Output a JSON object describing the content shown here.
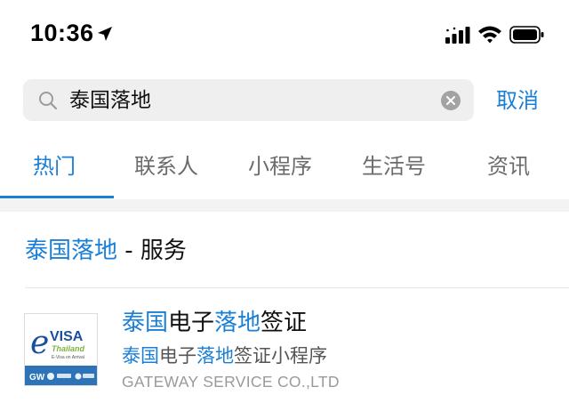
{
  "status_bar": {
    "time": "10:36",
    "icons": [
      "location-arrow-icon",
      "cellular-signal-icon",
      "wifi-icon",
      "battery-icon"
    ]
  },
  "search": {
    "query": "泰国落地",
    "cancel_label": "取消",
    "icons": [
      "search-icon",
      "clear-icon"
    ]
  },
  "tabs": [
    {
      "label": "热门",
      "active": true
    },
    {
      "label": "联系人",
      "active": false
    },
    {
      "label": "小程序",
      "active": false
    },
    {
      "label": "生活号",
      "active": false
    },
    {
      "label": "资讯",
      "active": false
    }
  ],
  "section": {
    "keyword": "泰国落地",
    "suffix": " - 服务"
  },
  "result": {
    "title": [
      {
        "text": "泰国",
        "hl": true
      },
      {
        "text": "电子",
        "hl": false
      },
      {
        "text": "落地",
        "hl": true
      },
      {
        "text": "签证",
        "hl": false
      }
    ],
    "subtitle": [
      {
        "text": "泰国",
        "hl": true
      },
      {
        "text": "电子",
        "hl": false
      },
      {
        "text": "落地",
        "hl": true
      },
      {
        "text": "签证小程序",
        "hl": false
      }
    ],
    "company": "GATEWAY SERVICE CO.,LTD",
    "logo": {
      "e_letter": "e",
      "visa": "VISA",
      "country": "Thailand",
      "tagline": "E-Visa on Arrival",
      "gw": "GW"
    }
  },
  "colors": {
    "accent": "#1a7fd6",
    "text": "#111111",
    "muted": "#6b6b6b",
    "search_bg": "#efefef",
    "divider": "#f3f3f3"
  }
}
